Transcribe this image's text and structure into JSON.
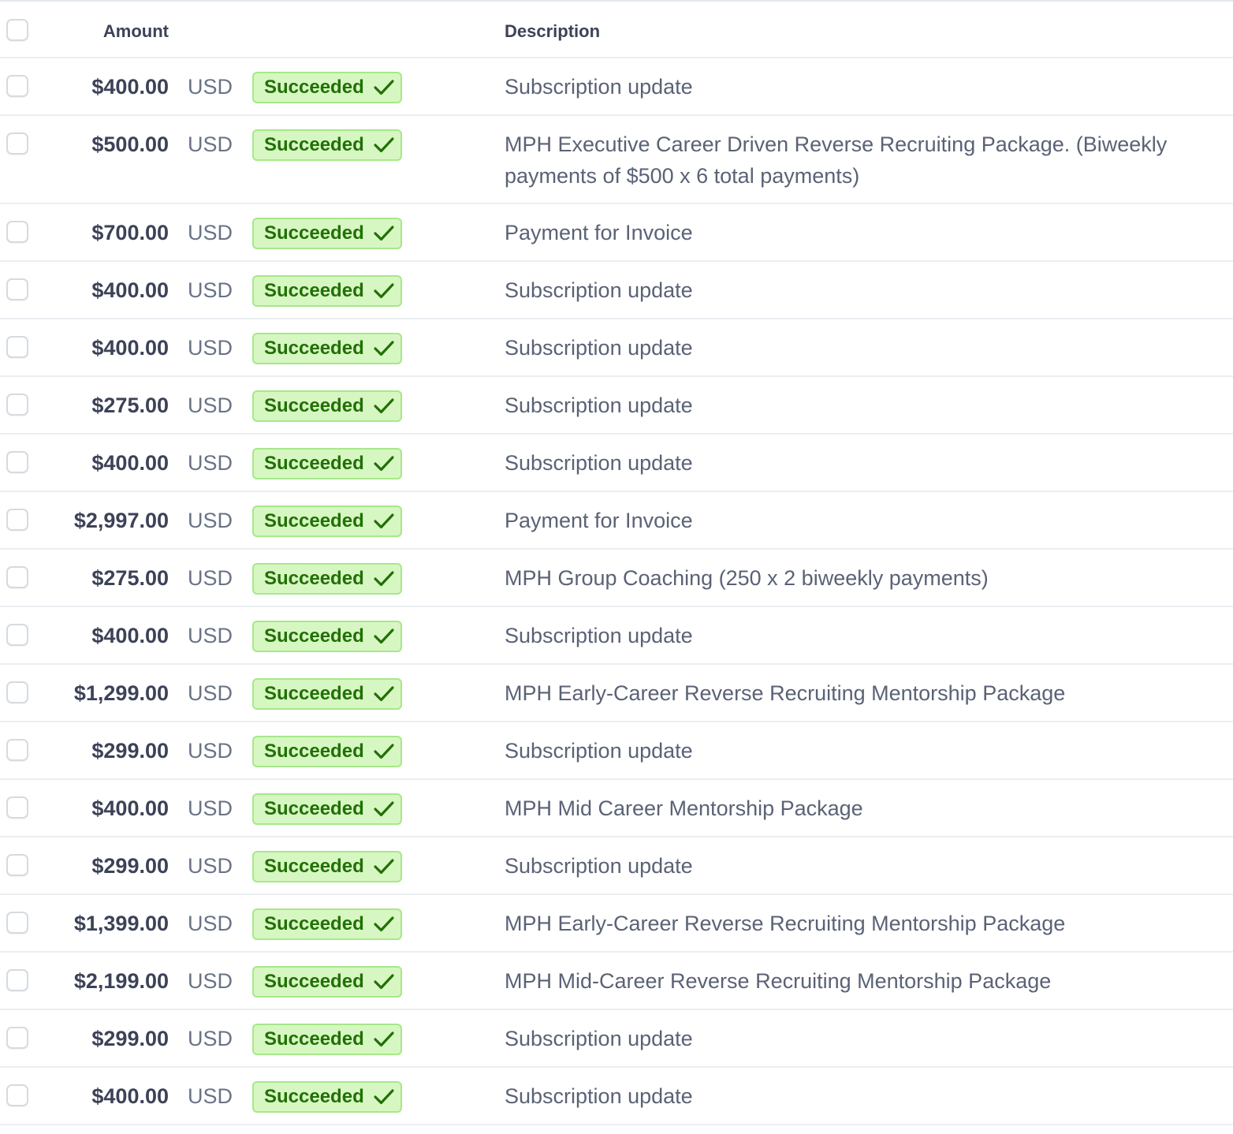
{
  "header": {
    "amount": "Amount",
    "description": "Description"
  },
  "rows": [
    {
      "amount": "$400.00",
      "currency": "USD",
      "status": "Succeeded",
      "description": "Subscription update"
    },
    {
      "amount": "$500.00",
      "currency": "USD",
      "status": "Succeeded",
      "description": "MPH Executive Career Driven Reverse Recruiting Package. (Biweekly payments of $500 x 6 total payments)"
    },
    {
      "amount": "$700.00",
      "currency": "USD",
      "status": "Succeeded",
      "description": "Payment for Invoice"
    },
    {
      "amount": "$400.00",
      "currency": "USD",
      "status": "Succeeded",
      "description": "Subscription update"
    },
    {
      "amount": "$400.00",
      "currency": "USD",
      "status": "Succeeded",
      "description": "Subscription update"
    },
    {
      "amount": "$275.00",
      "currency": "USD",
      "status": "Succeeded",
      "description": "Subscription update"
    },
    {
      "amount": "$400.00",
      "currency": "USD",
      "status": "Succeeded",
      "description": "Subscription update"
    },
    {
      "amount": "$2,997.00",
      "currency": "USD",
      "status": "Succeeded",
      "description": "Payment for Invoice"
    },
    {
      "amount": "$275.00",
      "currency": "USD",
      "status": "Succeeded",
      "description": "MPH Group Coaching (250 x 2 biweekly payments)"
    },
    {
      "amount": "$400.00",
      "currency": "USD",
      "status": "Succeeded",
      "description": "Subscription update"
    },
    {
      "amount": "$1,299.00",
      "currency": "USD",
      "status": "Succeeded",
      "description": "MPH Early-Career Reverse Recruiting Mentorship Package"
    },
    {
      "amount": "$299.00",
      "currency": "USD",
      "status": "Succeeded",
      "description": "Subscription update"
    },
    {
      "amount": "$400.00",
      "currency": "USD",
      "status": "Succeeded",
      "description": "MPH Mid Career Mentorship Package"
    },
    {
      "amount": "$299.00",
      "currency": "USD",
      "status": "Succeeded",
      "description": "Subscription update"
    },
    {
      "amount": "$1,399.00",
      "currency": "USD",
      "status": "Succeeded",
      "description": "MPH Early-Career Reverse Recruiting Mentorship Package"
    },
    {
      "amount": "$2,199.00",
      "currency": "USD",
      "status": "Succeeded",
      "description": "MPH Mid-Career Reverse Recruiting Mentorship Package"
    },
    {
      "amount": "$299.00",
      "currency": "USD",
      "status": "Succeeded",
      "description": "Subscription update"
    },
    {
      "amount": "$400.00",
      "currency": "USD",
      "status": "Succeeded",
      "description": "Subscription update"
    }
  ],
  "colors": {
    "badge_bg": "#d7f7c2",
    "badge_border": "#a6e88a",
    "badge_text": "#217005",
    "text_primary": "#3c4257",
    "text_secondary": "#697386"
  },
  "icons": {
    "status": "checkmark-icon"
  }
}
